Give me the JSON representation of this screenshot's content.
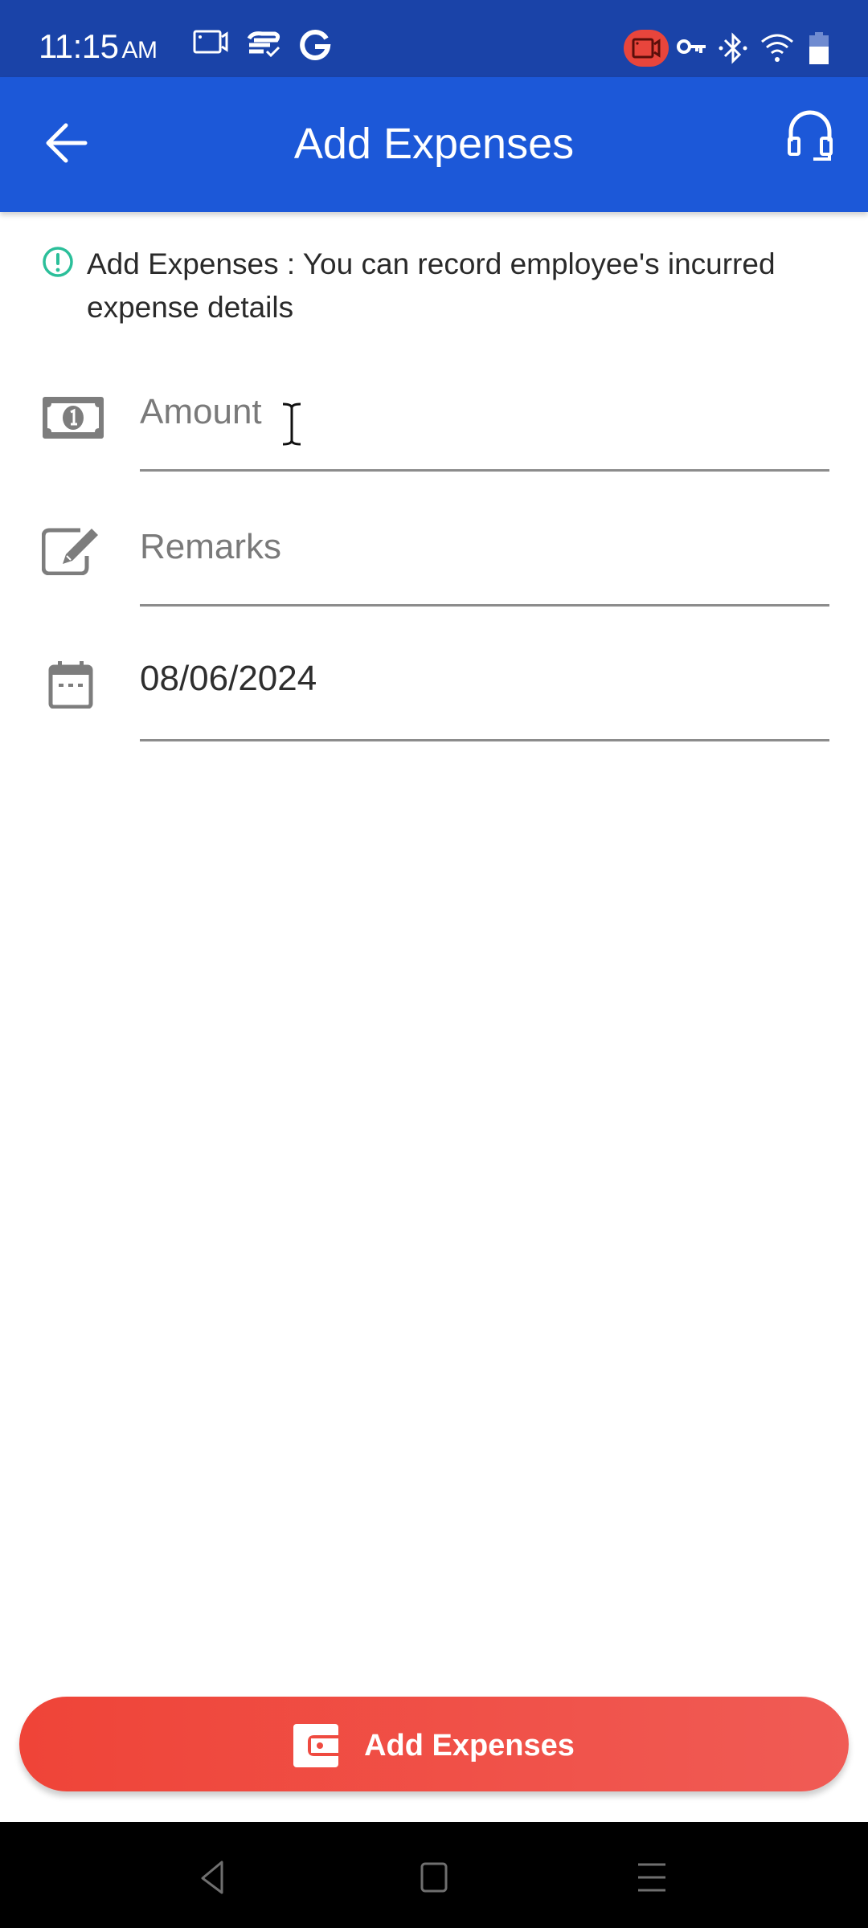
{
  "status_bar": {
    "time": "11:15",
    "ampm": "AM",
    "left_icons": [
      "screen-record-icon",
      "sync-check-icon",
      "google-icon"
    ],
    "right_icons": [
      "recording-badge-icon",
      "vpn-key-icon",
      "bluetooth-icon",
      "wifi-icon",
      "battery-icon"
    ]
  },
  "app_bar": {
    "title": "Add Expenses",
    "back_icon": "arrow-left-icon",
    "support_icon": "headset-icon"
  },
  "info": {
    "icon": "info-circle-icon",
    "text": "Add Expenses : You can record employee's incurred expense details",
    "accent_color": "#2bbf9a"
  },
  "form": {
    "amount": {
      "placeholder": "Amount",
      "value": "",
      "icon": "money-bill-icon"
    },
    "remarks": {
      "placeholder": "Remarks",
      "value": "",
      "icon": "edit-icon"
    },
    "date": {
      "value": "08/06/2024",
      "icon": "calendar-icon"
    }
  },
  "primary_button": {
    "label": "Add Expenses",
    "icon": "wallet-icon",
    "color": "#ef4438"
  },
  "nav_bar": {
    "buttons": [
      "back-nav",
      "home-nav",
      "recents-nav"
    ]
  }
}
